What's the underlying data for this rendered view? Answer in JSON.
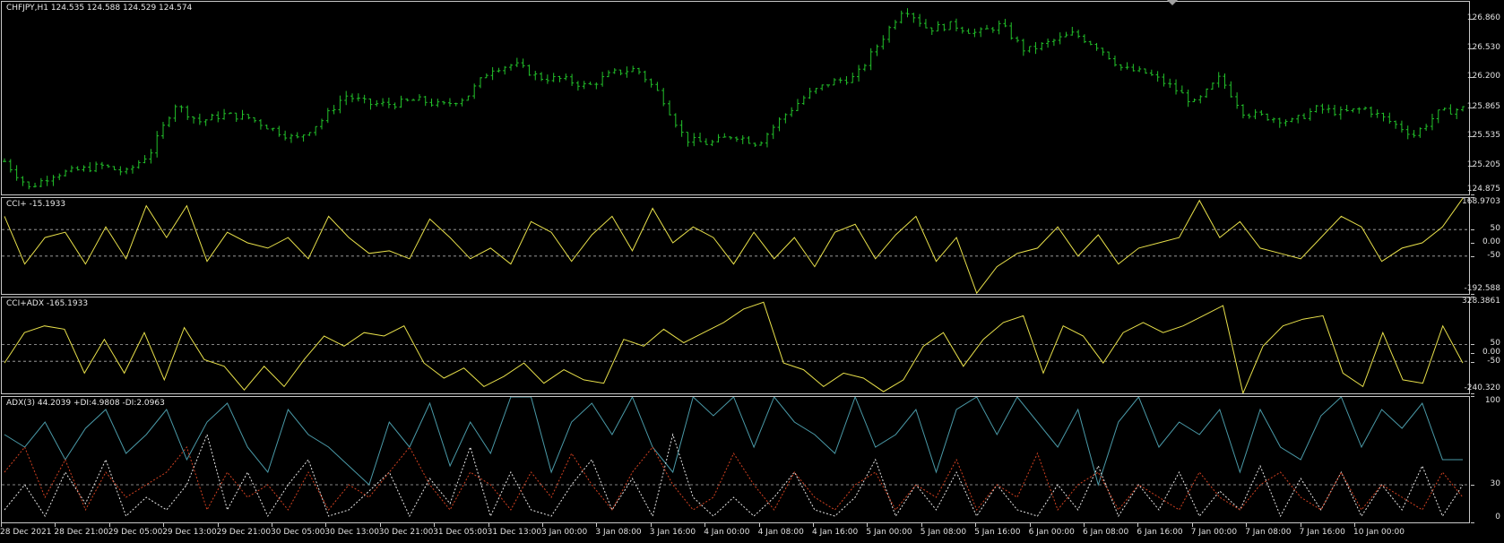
{
  "main_pane": {
    "title": "CHFJPY,H1  124.535 124.588 124.529 124.574",
    "bar_color": "#22c02a"
  },
  "cci_pane": {
    "title": "CCI+ -15.1933",
    "line_color": "#e8e04a"
  },
  "cciadx_pane": {
    "title": "CCI+ADX -165.1933",
    "line_color": "#e8e04a"
  },
  "adx_pane": {
    "title": "ADX(3) 44.2039 +DI:4.9808 -DI:2.0963",
    "adx_color": "#4a9aa8",
    "plus_di_color": "#e8e8e8",
    "minus_di_color": "#d04020"
  },
  "chart_data": [
    {
      "type": "ohlc",
      "symbol": "CHFJPY",
      "timeframe": "H1",
      "y_ticks": [
        "126.860",
        "126.530",
        "126.200",
        "125.865",
        "125.535",
        "125.205",
        "124.875"
      ],
      "ylim": [
        124.875,
        127.06
      ],
      "close_path": [
        125.25,
        124.95,
        125.1,
        125.15,
        125.2,
        125.12,
        125.35,
        125.9,
        125.7,
        125.78,
        125.75,
        125.62,
        125.5,
        125.7,
        126.0,
        125.9,
        125.9,
        125.95,
        125.88,
        125.98,
        126.3,
        126.35,
        126.2,
        126.18,
        126.1,
        126.25,
        126.3,
        126.0,
        125.5,
        125.45,
        125.55,
        125.45,
        125.75,
        126.0,
        126.15,
        126.2,
        126.6,
        127.0,
        126.75,
        126.8,
        126.7,
        126.8,
        126.5,
        126.6,
        126.7,
        126.55,
        126.3,
        126.25,
        126.1,
        125.9,
        126.2,
        125.8,
        125.75,
        125.7,
        125.85,
        125.8,
        125.85,
        125.7,
        125.55,
        125.8,
        125.85
      ]
    },
    {
      "type": "line",
      "name": "CCI+",
      "y_ticks": [
        "168.9703",
        "50",
        "0.00",
        "-50",
        "-192.588"
      ],
      "ylim": [
        -192.588,
        168.9703
      ],
      "levels": [
        50,
        -50
      ],
      "values": [
        100,
        -80,
        20,
        40,
        -80,
        60,
        -60,
        140,
        20,
        140,
        -70,
        40,
        0,
        -20,
        20,
        -60,
        100,
        20,
        -40,
        -30,
        -60,
        90,
        20,
        -60,
        -20,
        -80,
        80,
        40,
        -70,
        30,
        100,
        -30,
        130,
        0,
        60,
        20,
        -80,
        40,
        -60,
        20,
        -90,
        40,
        70,
        -60,
        30,
        100,
        -70,
        20,
        -190,
        -90,
        -40,
        -20,
        60,
        -50,
        30,
        -80,
        -20,
        0,
        20,
        160,
        20,
        80,
        -20,
        -40,
        -60,
        20,
        100,
        60,
        -70,
        -20,
        0,
        60,
        168
      ]
    },
    {
      "type": "line",
      "name": "CCI+ADX",
      "y_ticks": [
        "328.3861",
        "50",
        "0.00",
        "-50",
        "-240.320"
      ],
      "ylim": [
        -240.32,
        328.3861
      ],
      "levels": [
        50,
        -50
      ],
      "values": [
        -60,
        120,
        160,
        140,
        -120,
        80,
        -120,
        120,
        -160,
        150,
        -40,
        -80,
        -220,
        -80,
        -200,
        -40,
        100,
        40,
        120,
        100,
        160,
        -60,
        -150,
        -90,
        -200,
        -140,
        -60,
        -180,
        -100,
        -160,
        -180,
        80,
        40,
        140,
        60,
        120,
        180,
        260,
        300,
        -60,
        -100,
        -200,
        -120,
        -150,
        -230,
        -160,
        40,
        120,
        -80,
        80,
        180,
        220,
        -120,
        160,
        100,
        -60,
        120,
        180,
        120,
        160,
        220,
        280,
        -240,
        40,
        160,
        200,
        220,
        -120,
        -200,
        120,
        -160,
        -180,
        160,
        -60
      ]
    },
    {
      "type": "line",
      "name": "ADX(3)",
      "y_ticks": [
        "100",
        "30",
        "0"
      ],
      "ylim": [
        0,
        100
      ],
      "levels": [
        30
      ],
      "x_ticks": [
        "28 Dec 2021",
        "28 Dec 21:00",
        "29 Dec 05:00",
        "29 Dec 13:00",
        "29 Dec 21:00",
        "30 Dec 05:00",
        "30 Dec 13:00",
        "30 Dec 21:00",
        "31 Dec 05:00",
        "31 Dec 13:00",
        "3 Jan 00:00",
        "3 Jan 08:00",
        "3 Jan 16:00",
        "4 Jan 00:00",
        "4 Jan 08:00",
        "4 Jan 16:00",
        "5 Jan 00:00",
        "5 Jan 08:00",
        "5 Jan 16:00",
        "6 Jan 00:00",
        "6 Jan 08:00",
        "6 Jan 16:00",
        "7 Jan 00:00",
        "7 Jan 08:00",
        "7 Jan 16:00",
        "10 Jan 00:00"
      ],
      "series": [
        {
          "values": [
            70,
            60,
            80,
            50,
            75,
            90,
            55,
            70,
            90,
            50,
            80,
            95,
            60,
            40,
            90,
            70,
            60,
            45,
            30,
            80,
            60,
            95,
            45,
            80,
            55,
            100,
            100,
            40,
            80,
            95,
            70,
            100,
            60,
            40,
            100,
            85,
            100,
            60,
            100,
            80,
            70,
            55,
            100,
            60,
            70,
            90,
            40,
            90,
            100,
            70,
            100,
            80,
            60,
            90,
            30,
            80,
            100,
            60,
            80,
            70,
            90,
            40,
            90,
            60,
            50,
            85,
            100,
            60,
            90,
            75,
            95,
            50,
            50
          ]
        },
        {
          "values": [
            10,
            30,
            5,
            40,
            15,
            50,
            5,
            20,
            10,
            30,
            70,
            10,
            40,
            5,
            30,
            50,
            5,
            10,
            25,
            40,
            5,
            35,
            15,
            60,
            5,
            40,
            10,
            5,
            30,
            50,
            10,
            35,
            5,
            70,
            20,
            5,
            20,
            5,
            20,
            40,
            10,
            5,
            20,
            50,
            5,
            30,
            10,
            40,
            5,
            30,
            10,
            5,
            30,
            10,
            45,
            5,
            30,
            10,
            40,
            5,
            25,
            10,
            45,
            5,
            35,
            10,
            40,
            5,
            30,
            10,
            45,
            5,
            30
          ]
        },
        {
          "values": [
            40,
            60,
            20,
            50,
            10,
            40,
            20,
            30,
            40,
            60,
            10,
            40,
            20,
            30,
            10,
            40,
            10,
            30,
            20,
            40,
            60,
            30,
            10,
            40,
            30,
            10,
            40,
            20,
            55,
            30,
            10,
            40,
            60,
            30,
            10,
            20,
            55,
            30,
            10,
            40,
            20,
            10,
            30,
            40,
            10,
            30,
            20,
            50,
            10,
            30,
            20,
            55,
            10,
            30,
            40,
            10,
            30,
            20,
            10,
            40,
            20,
            10,
            30,
            40,
            20,
            10,
            40,
            10,
            30,
            20,
            10,
            40,
            20
          ]
        }
      ]
    }
  ]
}
